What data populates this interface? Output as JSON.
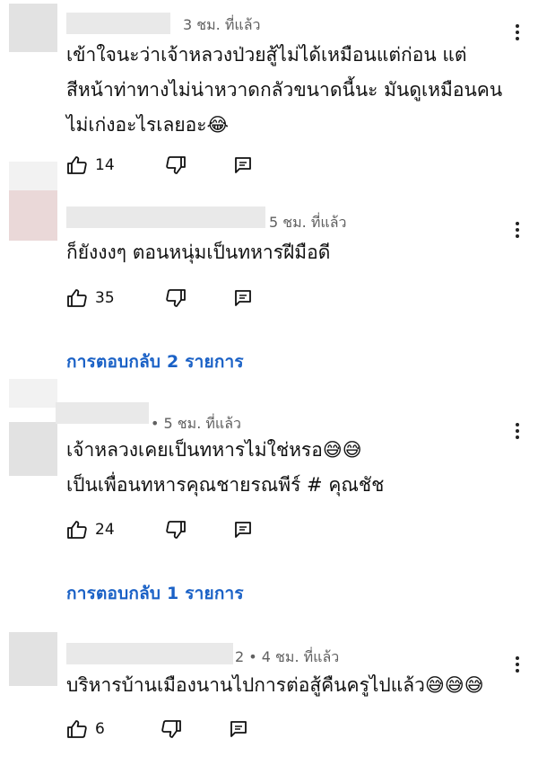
{
  "comments": [
    {
      "time": "3 ชม. ที่แล้ว",
      "lines": [
        "เข้าใจนะว่าเจ้าหลวงป่วยสู้ไม่ได้เหมือนแต่ก่อน แต่",
        "สีหน้าท่าทางไม่น่าหวาดกลัวขนาดนี้นะ มันดูเหมือนคน",
        "ไม่เก่งอะไรเลยอะ😂"
      ],
      "likes": "14"
    },
    {
      "time": "5 ชม. ที่แล้ว",
      "lines": [
        "ก็ยังงงๆ ตอนหนุ่มเป็นทหารฝีมือดี"
      ],
      "likes": "35",
      "replies": "การตอบกลับ 2 รายการ"
    },
    {
      "time": "• 5 ชม. ที่แล้ว",
      "lines": [
        "เจ้าหลวงเคยเป็นทหารไม่ใช่หรอ😅😅",
        " เป็นเพื่อนทหารคุณชายรณพีร์ # คุณชัช"
      ],
      "likes": "24",
      "replies": "การตอบกลับ 1 รายการ"
    },
    {
      "time": "2 • 4 ชม. ที่แล้ว",
      "lines": [
        "บริหารบ้านเมืองนานไปการต่อสู้คืนครูไปแล้ว😅😅😅"
      ],
      "likes": "6"
    }
  ]
}
